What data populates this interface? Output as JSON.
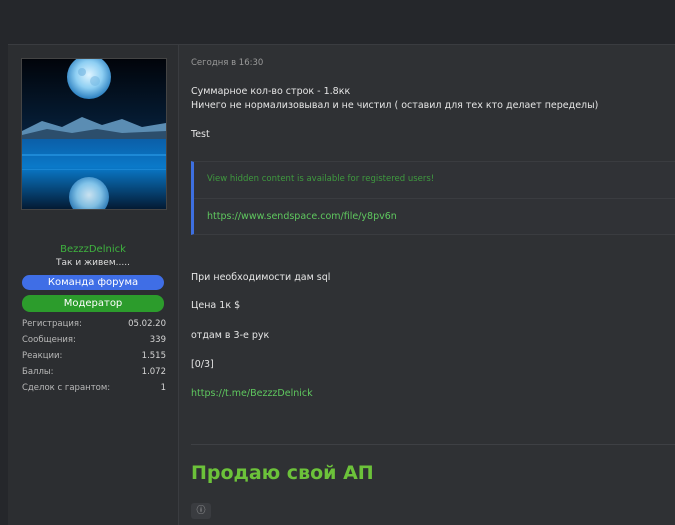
{
  "user": {
    "username": "BezzzDelnick",
    "title": "Так и живем.....",
    "badges": {
      "team": "Команда форума",
      "moderator": "Модератор"
    },
    "stats": [
      {
        "label": "Регистрация:",
        "value": "05.02.20"
      },
      {
        "label": "Сообщения:",
        "value": "339"
      },
      {
        "label": "Реакции:",
        "value": "1.515"
      },
      {
        "label": "Баллы:",
        "value": "1.072"
      },
      {
        "label": "Сделок с гарантом:",
        "value": "1"
      }
    ]
  },
  "post": {
    "date": "Сегодня в 16:30",
    "line1": "Суммарное кол-во строк - 1.8кк",
    "line2": "Ничего не нормализовывал и не чистил ( оставил для тех кто делает переделы)",
    "line3": "Test",
    "hidden_title": "View hidden content is available for registered users!",
    "hidden_link": "https://www.sendspace.com/file/y8pv6n",
    "line4": "При необходимости дам sql",
    "line5": "Цена 1к $",
    "line6": "отдам в 3-е рук",
    "line7": "[0/3]",
    "contact_link": "https://t.me/BezzzDelnick"
  },
  "next_thread": {
    "title": "Продаю свой АП"
  },
  "colors": {
    "accent_green": "#5fc85f",
    "badge_blue": "#3f6ee6",
    "badge_green": "#2c9c2c"
  }
}
